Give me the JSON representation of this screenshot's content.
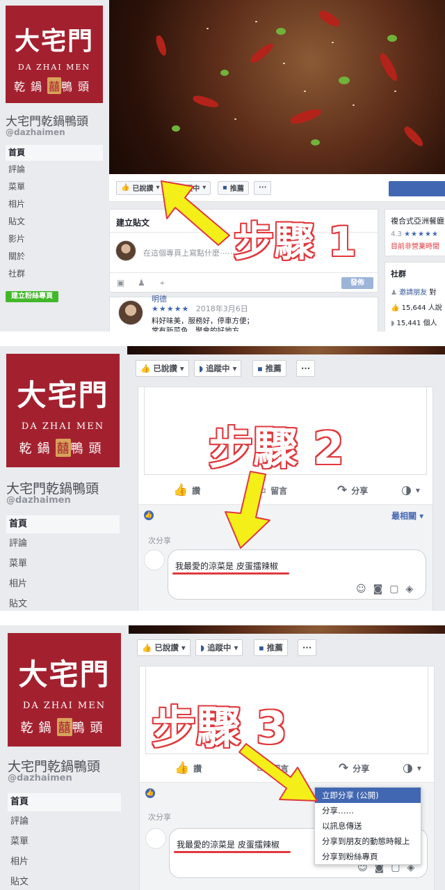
{
  "page": {
    "name": "大宅門乾鍋鴨頭",
    "handle": "@dazhaimen",
    "logo_cn": "大宅門",
    "logo_en": "DA ZHAI MEN",
    "logo_sub_1": "乾",
    "logo_sub_2": "鍋",
    "logo_sub_seal": "囍",
    "logo_sub_3": "鴨",
    "logo_sub_4": "頭"
  },
  "nav": {
    "items": [
      "首頁",
      "評論",
      "菜單",
      "相片",
      "貼文",
      "影片",
      "關於",
      "社群"
    ],
    "create_fan_page": "建立粉絲專頁"
  },
  "actions": {
    "liked": "已說讚",
    "following": "追蹤中",
    "recommend": "推薦",
    "more": "···"
  },
  "composer": {
    "title": "建立貼文",
    "placeholder": "在這個專頁上寫點什麼⋯⋯",
    "post_button": "發佈"
  },
  "review": {
    "author": "明德",
    "stars": "★★★★★",
    "date": "2018年3月6日",
    "line1": "料好味美，服務好，停車方便；",
    "line2": "常有新菜色，聚會的好地方。"
  },
  "sidebar_right": {
    "category": "複合式亞洲餐廳",
    "rating": "4.3",
    "rating_stars": "★★★★★",
    "open_status": "目前非營業時間",
    "community_title": "社群",
    "invite": "邀請朋友",
    "invite_rest": "對",
    "likes": "15,644 人說",
    "follows": "15,441 個人"
  },
  "post": {
    "like": "讚",
    "comment": "留言",
    "share": "分享",
    "sort": "最相關 ▾",
    "shares_label": "次分享",
    "comment_text": "我最愛的涼菜是 皮蛋擂辣椒"
  },
  "share_menu": {
    "items": [
      "立即分享 (公開)",
      "分享……",
      "以訊息傳送",
      "分享到朋友的動態時報上",
      "分享到粉絲專頁"
    ]
  },
  "steps": {
    "s1": "步驟 1",
    "s2": "步驟 2",
    "s3": "步驟 3"
  },
  "colors": {
    "brand_red": "#a3212f",
    "fb_blue": "#4267b2",
    "annotation_red": "#e0393e",
    "arrow_yellow": "#f4ef18"
  }
}
